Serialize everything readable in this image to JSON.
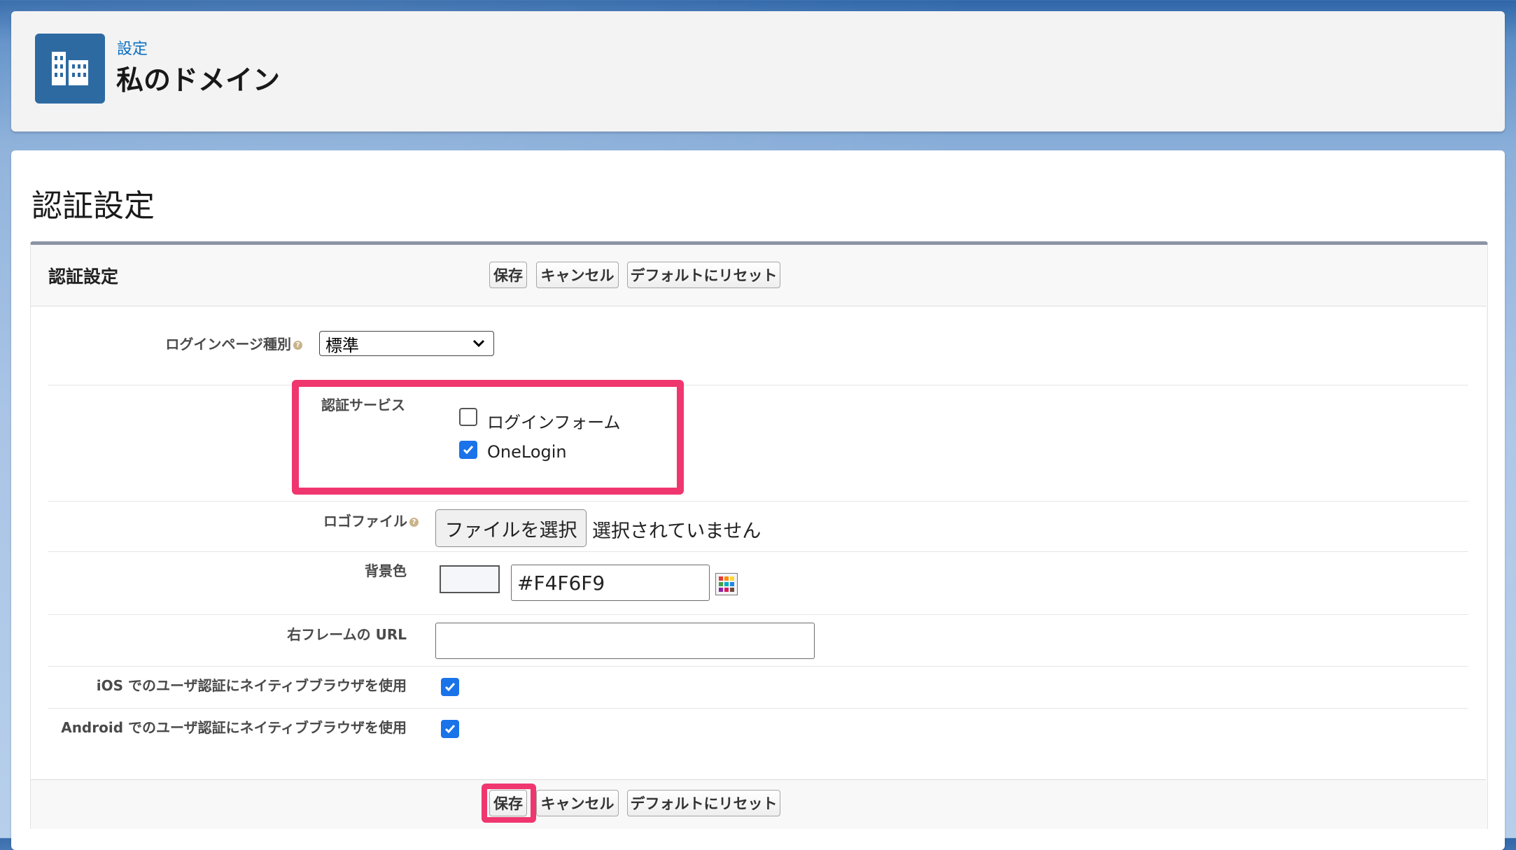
{
  "header": {
    "breadcrumb": "設定",
    "title": "私のドメイン",
    "icon": "building-icon",
    "accent": "#2d6aa2"
  },
  "page": {
    "title": "認証設定"
  },
  "block": {
    "title": "認証設定",
    "buttons": {
      "save": "保存",
      "cancel": "キャンセル",
      "reset": "デフォルトにリセット"
    }
  },
  "fields": {
    "login_page_type": {
      "label": "ログインページ種別",
      "value": "標準"
    },
    "auth_service": {
      "label": "認証サービス",
      "options": [
        {
          "label": "ログインフォーム",
          "checked": false
        },
        {
          "label": "OneLogin",
          "checked": true
        }
      ]
    },
    "logo_file": {
      "label": "ロゴファイル",
      "button": "ファイルを選択",
      "status": "選択されていません"
    },
    "background_color": {
      "label": "背景色",
      "value": "#F4F6F9"
    },
    "right_frame_url": {
      "label": "右フレームの URL",
      "value": ""
    },
    "ios_native_browser": {
      "label": "iOS でのユーザ認証にネイティブブラウザを使用",
      "checked": true
    },
    "android_native_browser": {
      "label": "Android でのユーザ認証にネイティブブラウザを使用",
      "checked": true
    }
  },
  "colors": {
    "highlight": "#f0366f",
    "checkbox": "#1a73e8"
  }
}
